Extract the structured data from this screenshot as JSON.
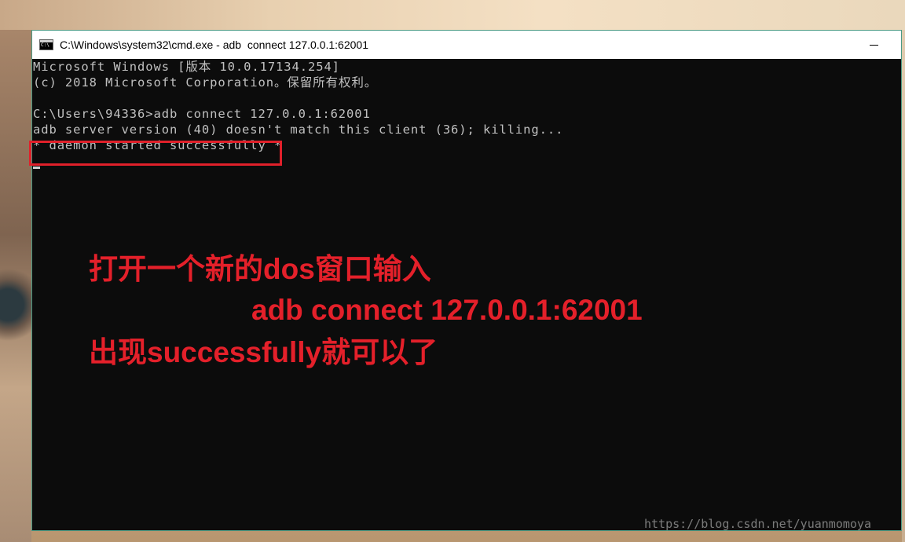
{
  "window": {
    "title": "C:\\Windows\\system32\\cmd.exe - adb  connect 127.0.0.1:62001"
  },
  "console": {
    "lines": [
      "Microsoft Windows [版本 10.0.17134.254]",
      "(c) 2018 Microsoft Corporation。保留所有权利。",
      "",
      "C:\\Users\\94336>adb connect 127.0.0.1:62001",
      "adb server version (40) doesn't match this client (36); killing...",
      "* daemon started successfully *"
    ]
  },
  "annotations": {
    "line1": "打开一个新的dos窗口输入",
    "line2": "adb connect 127.0.0.1:62001",
    "line3": "出现successfully就可以了"
  },
  "watermark": "https://blog.csdn.net/yuanmomoya",
  "colors": {
    "annotation_red": "#e4202a",
    "console_bg": "#0c0c0c",
    "console_text": "#c0c0c0"
  },
  "icons": {
    "app": "cmd-icon",
    "minimize": "minimize-icon"
  }
}
